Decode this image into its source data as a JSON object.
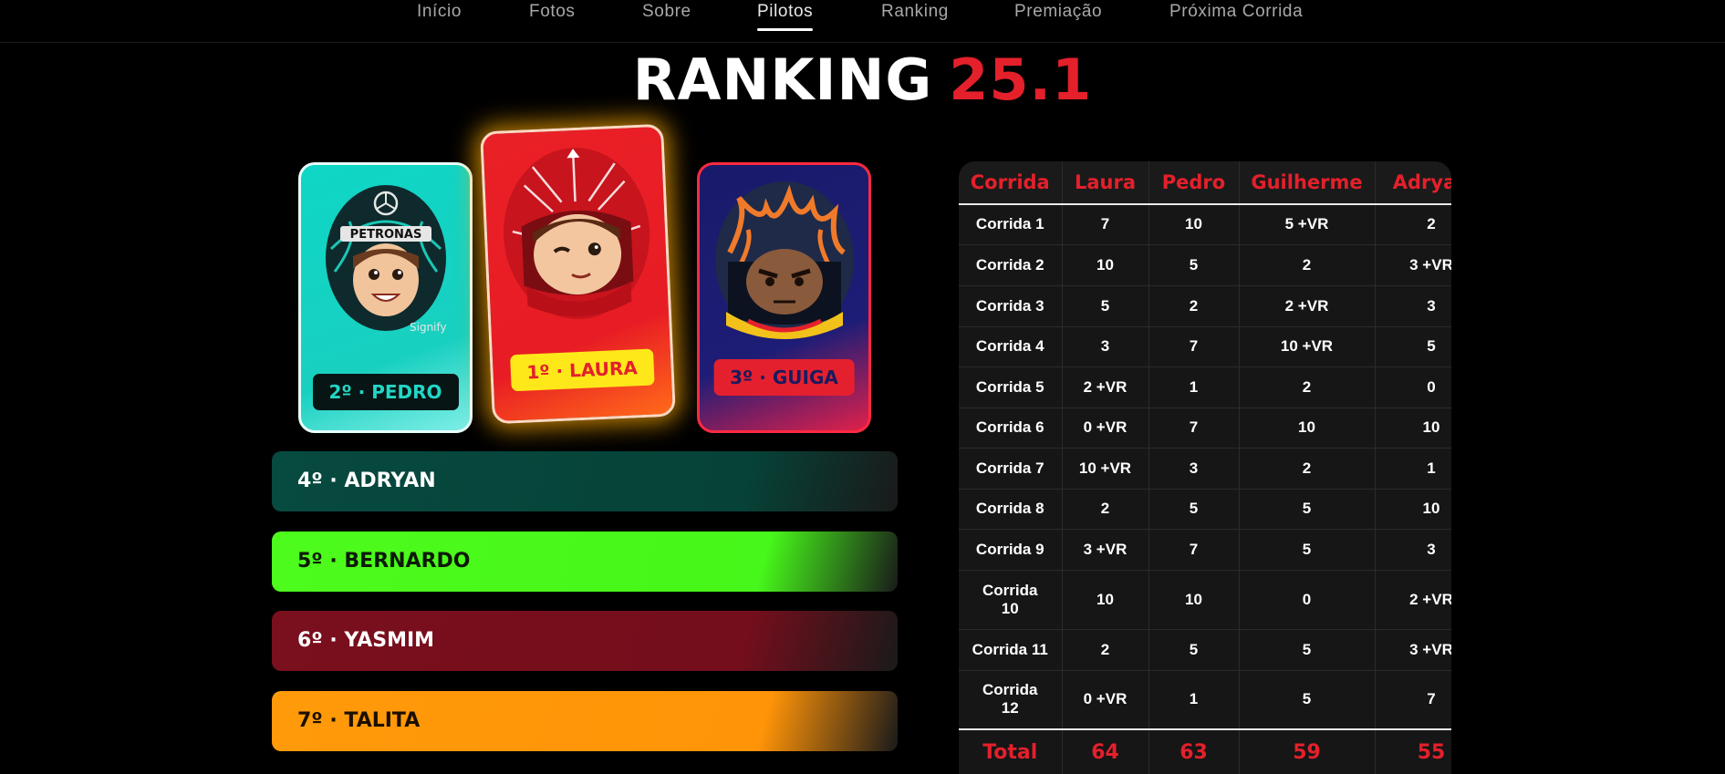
{
  "nav": {
    "items": [
      {
        "label": "Início",
        "active": false
      },
      {
        "label": "Fotos",
        "active": false
      },
      {
        "label": "Sobre",
        "active": false
      },
      {
        "label": "Pilotos",
        "active": true
      },
      {
        "label": "Ranking",
        "active": false
      },
      {
        "label": "Premiação",
        "active": false
      },
      {
        "label": "Próxima Corrida",
        "active": false
      }
    ]
  },
  "title": {
    "main": "RANKING",
    "accent": "25.1"
  },
  "podium": [
    {
      "label": "2º · PEDRO",
      "helmet": "mercedes-helmet-avatar",
      "color": "#18d0c0"
    },
    {
      "label": "1º · LAURA",
      "helmet": "red-helmet-avatar",
      "color": "#e81c24"
    },
    {
      "label": "3º · GUIGA",
      "helmet": "navy-flame-helmet-avatar",
      "color": "#1d1d77"
    }
  ],
  "ranks": [
    {
      "label": "4º · ADRYAN",
      "color": "#064237"
    },
    {
      "label": "5º · BERNARDO",
      "color": "#47f61a"
    },
    {
      "label": "6º · YASMIM",
      "color": "#740e1c"
    },
    {
      "label": "7º · TALITA",
      "color": "#ff9408"
    }
  ],
  "table": {
    "headers": [
      "Corrida",
      "Laura",
      "Pedro",
      "Guilherme",
      "Adryan"
    ],
    "rows": [
      [
        "Corrida 1",
        "7",
        "10",
        "5 +VR",
        "2"
      ],
      [
        "Corrida 2",
        "10",
        "5",
        "2",
        "3 +VR"
      ],
      [
        "Corrida 3",
        "5",
        "2",
        "2 +VR",
        "3"
      ],
      [
        "Corrida 4",
        "3",
        "7",
        "10 +VR",
        "5"
      ],
      [
        "Corrida 5",
        "2 +VR",
        "1",
        "2",
        "0"
      ],
      [
        "Corrida 6",
        "0 +VR",
        "7",
        "10",
        "10"
      ],
      [
        "Corrida 7",
        "10 +VR",
        "3",
        "2",
        "1"
      ],
      [
        "Corrida 8",
        "2",
        "5",
        "5",
        "10"
      ],
      [
        "Corrida 9",
        "3 +VR",
        "7",
        "5",
        "3"
      ],
      [
        "Corrida 10",
        "10",
        "10",
        "0",
        "2 +VR"
      ],
      [
        "Corrida 11",
        "2",
        "5",
        "5",
        "3 +VR"
      ],
      [
        "Corrida 12",
        "0 +VR",
        "1",
        "5",
        "7"
      ]
    ],
    "total": [
      "Total",
      "64",
      "63",
      "59",
      "55"
    ]
  },
  "colors": {
    "accent": "#e4202b",
    "background": "#000000",
    "table_bg": "#161616"
  }
}
